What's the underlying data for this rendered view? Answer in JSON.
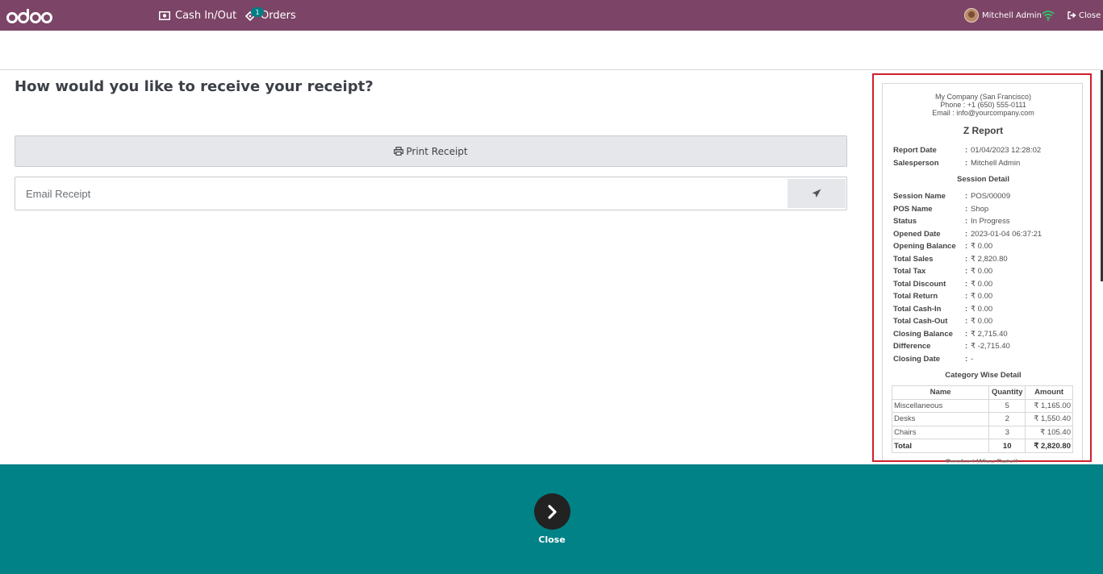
{
  "navbar": {
    "logo_text": "odoo",
    "cash_label": "Cash In/Out",
    "orders_label": "Orders",
    "orders_count": "1",
    "user_name": "Mitchell Admin",
    "close_label": "Close",
    "bg_color": "#7c4466"
  },
  "main": {
    "question": "How would you like to receive your receipt?",
    "print_label": "Print Receipt",
    "email_placeholder": "Email Receipt"
  },
  "receipt": {
    "company_name": "My Company (San Francisco)",
    "company_phone": "Phone : +1 (650) 555-0111",
    "company_email": "Email : info@yourcompany.com",
    "title": "Z Report",
    "header_rows": [
      {
        "label": "Report Date",
        "value": "01/04/2023 12:28:02"
      },
      {
        "label": "Salesperson",
        "value": "Mitchell Admin"
      }
    ],
    "session_heading": "Session Detail",
    "session_rows": [
      {
        "label": "Session Name",
        "value": "POS/00009"
      },
      {
        "label": "POS Name",
        "value": "Shop"
      },
      {
        "label": "Status",
        "value": "In Progress"
      },
      {
        "label": "Opened Date",
        "value": "2023-01-04 06:37:21"
      },
      {
        "label": "Opening Balance",
        "value": "₹ 0.00"
      },
      {
        "label": "Total Sales",
        "value": "₹ 2,820.80"
      },
      {
        "label": "Total Tax",
        "value": "₹ 0.00"
      },
      {
        "label": "Total Discount",
        "value": "₹ 0.00"
      },
      {
        "label": "Total Return",
        "value": "₹ 0.00"
      },
      {
        "label": "Total Cash-In",
        "value": "₹ 0.00"
      },
      {
        "label": "Total Cash-Out",
        "value": "₹ 0.00"
      },
      {
        "label": "Closing Balance",
        "value": "₹ 2,715.40"
      },
      {
        "label": "Difference",
        "value": "₹ -2,715.40"
      },
      {
        "label": "Closing Date",
        "value": "-"
      }
    ],
    "category_heading": "Category Wise Detail",
    "table_headers": [
      "Name",
      "Quantity",
      "Amount"
    ],
    "table_rows": [
      {
        "name": "Miscellaneous",
        "qty": "5",
        "amount": "₹ 1,165.00"
      },
      {
        "name": "Desks",
        "qty": "2",
        "amount": "₹ 1,550.40"
      },
      {
        "name": "Chairs",
        "qty": "3",
        "amount": "₹ 105.40"
      }
    ],
    "table_total": {
      "name": "Total",
      "qty": "10",
      "amount": "₹ 2,820.80"
    },
    "product_heading": "Product Wise Detail"
  },
  "bottom": {
    "close_label": "Close",
    "bg_color": "#018287"
  }
}
